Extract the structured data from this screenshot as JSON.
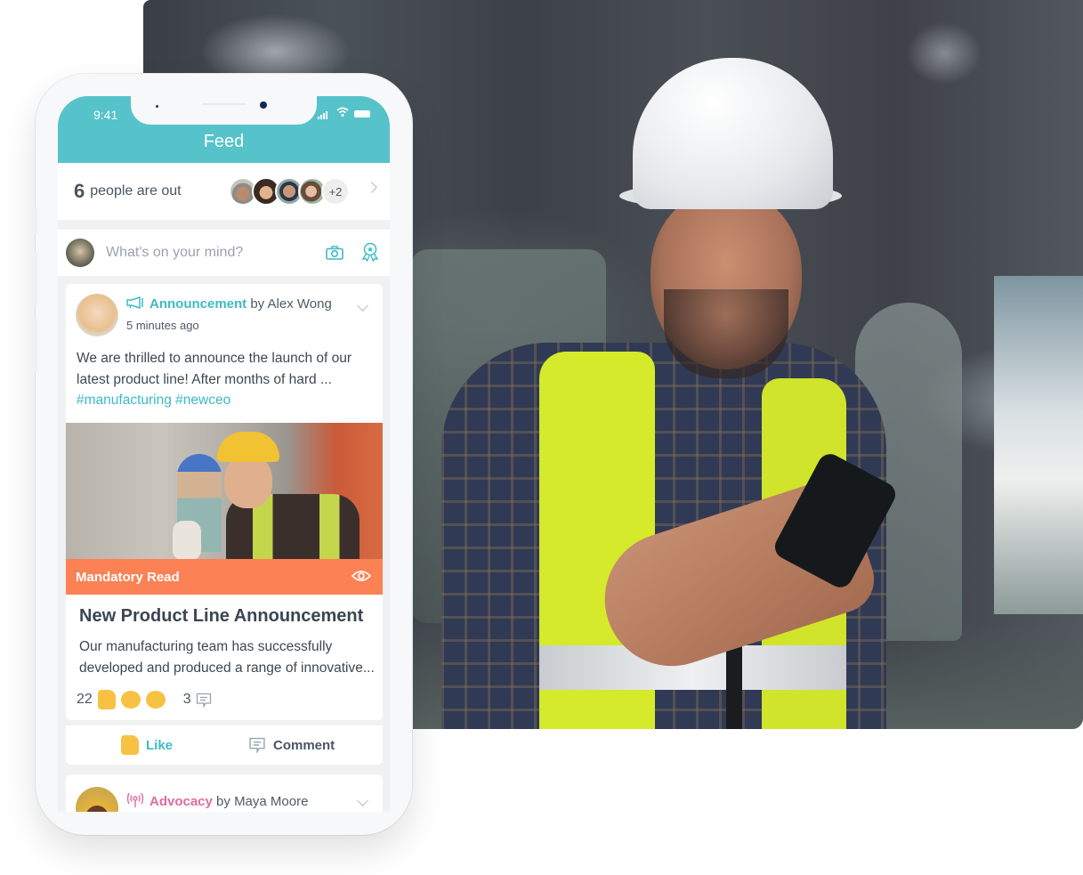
{
  "status_bar": {
    "time": "9:41"
  },
  "header": {
    "title": "Feed"
  },
  "people_out": {
    "count": "6",
    "label": "people are out",
    "more_count": "+2",
    "avatars": [
      "person-hat",
      "person-glasses-woman",
      "person-man-smiling",
      "person-woman"
    ]
  },
  "composer": {
    "placeholder": "What's on your mind?",
    "camera_icon": "camera-icon",
    "award_icon": "award-icon"
  },
  "posts": [
    {
      "category": "Announcement",
      "author_prefix": "by",
      "author": "Alex Wong",
      "time": "5 minutes ago",
      "body": "We are thrilled to announce the launch of our latest product line! After months of hard ...",
      "tags": "#manufacturing #newceo",
      "banner": "Mandatory Read",
      "article_title": "New Product Line Announcement",
      "article_desc_line1": "Our manufacturing team has successfully",
      "article_desc_line2": "developed and produced a range of innovative...",
      "reaction_count": "22",
      "reactions": [
        "thumbs-up",
        "laughing",
        "crying"
      ],
      "comment_count": "3",
      "like_label": "Like",
      "comment_label": "Comment"
    },
    {
      "category": "Advocacy",
      "author_prefix": "by",
      "author": "Maya Moore"
    }
  ],
  "colors": {
    "accent": "#56c3ca",
    "link": "#3dbbc4",
    "mandatory": "#fc8154",
    "advocacy": "#e06ba2",
    "text": "#4a5561"
  }
}
